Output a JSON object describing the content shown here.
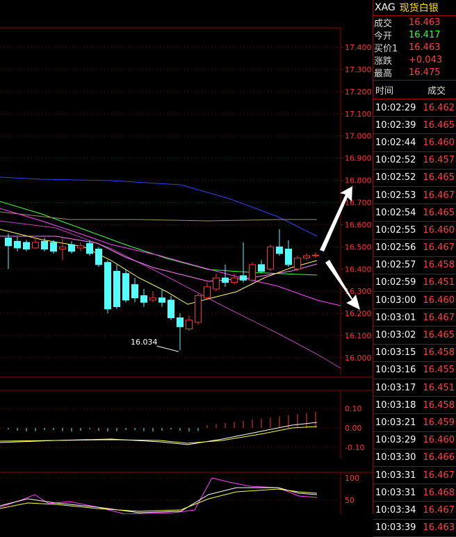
{
  "panel": {
    "symbol": "XAG",
    "name": "现货白银",
    "quotes": [
      {
        "label": "成交",
        "value": "16.463",
        "color": "red"
      },
      {
        "label": "今开",
        "value": "16.417",
        "color": "green"
      },
      {
        "label": "买价1",
        "value": "16.463",
        "color": "red"
      },
      {
        "label": "涨跌",
        "value": "+0.043",
        "color": "red"
      },
      {
        "label": "最高",
        "value": "16.475",
        "color": "red"
      }
    ],
    "ticks_header": {
      "time": "时间",
      "price": "成交"
    },
    "ticks": [
      {
        "time": "10:02:29",
        "price": "16.462"
      },
      {
        "time": "10:02:39",
        "price": "16.465"
      },
      {
        "time": "10:02:44",
        "price": "16.460"
      },
      {
        "time": "10:02:52",
        "price": "16.457"
      },
      {
        "time": "10:02:52",
        "price": "16.465"
      },
      {
        "time": "10:02:53",
        "price": "16.467"
      },
      {
        "time": "10:02:54",
        "price": "16.465"
      },
      {
        "time": "10:02:55",
        "price": "16.460"
      },
      {
        "time": "10:02:56",
        "price": "16.467"
      },
      {
        "time": "10:02:57",
        "price": "16.458"
      },
      {
        "time": "10:02:59",
        "price": "16.451"
      },
      {
        "time": "10:03:00",
        "price": "16.460"
      },
      {
        "time": "10:03:01",
        "price": "16.467"
      },
      {
        "time": "10:03:02",
        "price": "16.465"
      },
      {
        "time": "10:03:15",
        "price": "16.458"
      },
      {
        "time": "10:03:16",
        "price": "16.455"
      },
      {
        "time": "10:03:17",
        "price": "16.451"
      },
      {
        "time": "10:03:18",
        "price": "16.458"
      },
      {
        "time": "10:03:21",
        "price": "16.459"
      },
      {
        "time": "10:03:29",
        "price": "16.460"
      },
      {
        "time": "10:03:30",
        "price": "16.466"
      },
      {
        "time": "10:03:31",
        "price": "16.467"
      },
      {
        "time": "10:03:31",
        "price": "16.468"
      },
      {
        "time": "10:03:34",
        "price": "16.467"
      },
      {
        "time": "10:03:39",
        "price": "16.463"
      }
    ]
  },
  "chart": {
    "price_axis": [
      "17.400",
      "17.300",
      "17.200",
      "17.100",
      "17.000",
      "16.900",
      "16.800",
      "16.700",
      "16.600",
      "16.500",
      "16.400",
      "16.300",
      "16.200",
      "16.100",
      "16.000"
    ],
    "low_label": "16.034",
    "macd_axis": [
      "0.10",
      "0.00",
      "-0.10"
    ],
    "kdj_axis": [
      "100",
      "50"
    ],
    "colors": {
      "up": "#ff3232",
      "down": "#54ffff",
      "grid": "#8b0000",
      "axis_text": "#ff3232"
    }
  }
}
